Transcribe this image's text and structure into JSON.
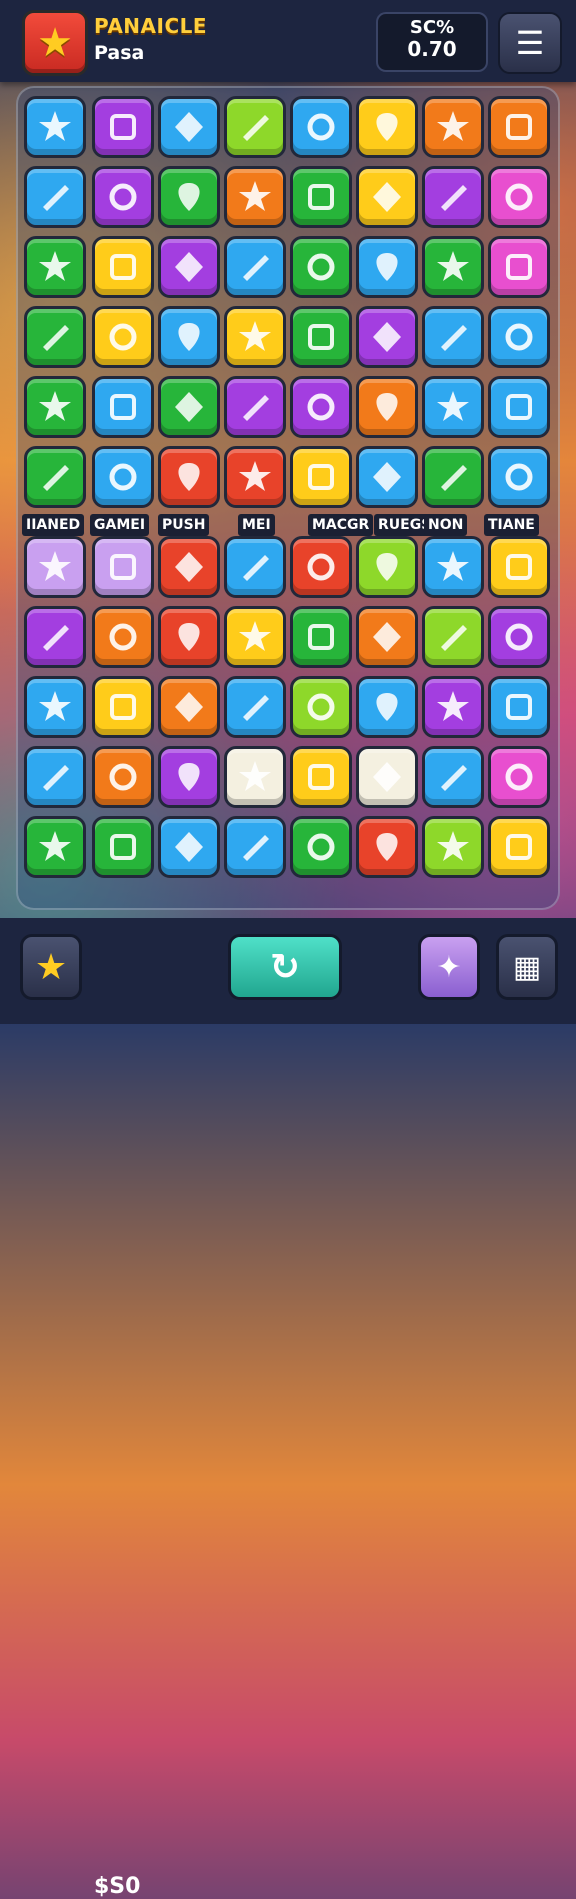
{
  "header": {
    "title": "PANAICLE",
    "subtitle": "Pasa",
    "score_label": "SC%",
    "score_value": "0.70",
    "logo_icon": "star-icon",
    "menu_icon": "hamburger-icon"
  },
  "board": {
    "rows": [
      [
        "blue",
        "purple",
        "blue",
        "lime",
        "blue",
        "yellow",
        "orange",
        "orange"
      ],
      [
        "blue",
        "purple",
        "green",
        "orange",
        "green",
        "yellow",
        "purple",
        "pink"
      ],
      [
        "green",
        "yellow",
        "purple",
        "blue",
        "green",
        "blue",
        "green",
        "pink"
      ],
      [
        "green",
        "yellow",
        "blue",
        "yellow",
        "green",
        "purple",
        "blue",
        "blue"
      ],
      [
        "green",
        "blue",
        "green",
        "purple",
        "purple",
        "orange",
        "blue",
        "blue"
      ],
      [
        "green",
        "blue",
        "red",
        "red",
        "yellow",
        "blue",
        "green",
        "blue"
      ],
      [
        "lavender",
        "lavender",
        "red",
        "blue",
        "red",
        "lime",
        "blue",
        "yellow"
      ],
      [
        "purple",
        "orange",
        "red",
        "yellow",
        "green",
        "orange",
        "lime",
        "purple"
      ],
      [
        "blue",
        "yellow",
        "orange",
        "blue",
        "lime",
        "blue",
        "purple",
        "blue"
      ],
      [
        "blue",
        "orange",
        "purple",
        "white",
        "yellow",
        "white",
        "blue",
        "pink"
      ],
      [
        "green",
        "green",
        "blue",
        "blue",
        "green",
        "red",
        "lime",
        "yellow"
      ]
    ]
  },
  "labels": [
    "IIANED",
    "GAMEI",
    "PUSH",
    "MEI",
    "MACGR",
    "RUEGSS",
    "NON",
    "TIANE"
  ],
  "footer": {
    "coins": "$S0",
    "star_icon": "star-icon",
    "refresh_icon": "refresh-icon",
    "magic_icon": "magic-icon",
    "grid_icon": "grid-icon"
  },
  "colors": {
    "blue": "#2fa8f0",
    "purple": "#a33ee0",
    "lime": "#8ed82a",
    "yellow": "#ffcc1a",
    "orange": "#f27a1a",
    "green": "#27b53a",
    "pink": "#e84fcf",
    "red": "#e8432a",
    "lavender": "#c9a0f0",
    "white": "#f4f0e0"
  }
}
